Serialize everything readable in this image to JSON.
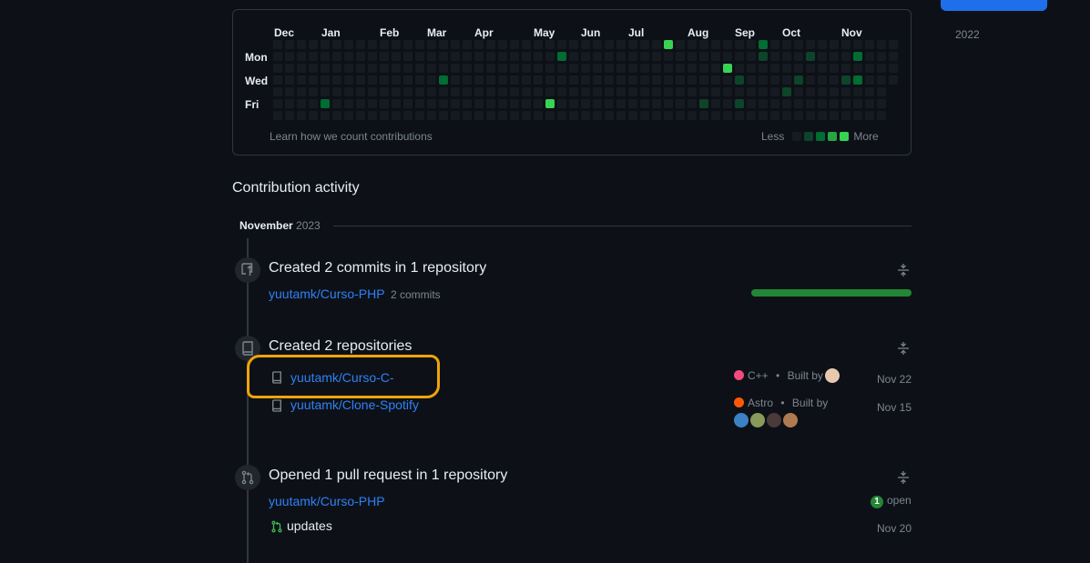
{
  "sidebar": {
    "year": "2022"
  },
  "graph": {
    "months": [
      "Dec",
      "Jan",
      "Feb",
      "Mar",
      "Apr",
      "May",
      "Jun",
      "Jul",
      "Aug",
      "Sep",
      "Oct",
      "Nov"
    ],
    "days": [
      "Mon",
      "Wed",
      "Fri"
    ],
    "learn_link": "Learn how we count contributions",
    "legend_less": "Less",
    "legend_more": "More",
    "colors": [
      "#161b22",
      "#0e4429",
      "#006d32",
      "#26a641",
      "#39d353"
    ],
    "active_cells": [
      {
        "week": 4,
        "day": 5,
        "level": 2
      },
      {
        "week": 14,
        "day": 3,
        "level": 2
      },
      {
        "week": 23,
        "day": 5,
        "level": 4
      },
      {
        "week": 24,
        "day": 1,
        "level": 2
      },
      {
        "week": 33,
        "day": 0,
        "level": 4
      },
      {
        "week": 36,
        "day": 5,
        "level": 1
      },
      {
        "week": 38,
        "day": 2,
        "level": 4
      },
      {
        "week": 39,
        "day": 3,
        "level": 1
      },
      {
        "week": 39,
        "day": 5,
        "level": 1
      },
      {
        "week": 41,
        "day": 0,
        "level": 2
      },
      {
        "week": 41,
        "day": 1,
        "level": 1
      },
      {
        "week": 43,
        "day": 4,
        "level": 1
      },
      {
        "week": 44,
        "day": 3,
        "level": 1
      },
      {
        "week": 45,
        "day": 1,
        "level": 1
      },
      {
        "week": 48,
        "day": 3,
        "level": 1
      },
      {
        "week": 49,
        "day": 1,
        "level": 2
      },
      {
        "week": 49,
        "day": 3,
        "level": 2
      }
    ]
  },
  "activity": {
    "title": "Contribution activity",
    "month": "November",
    "year": "2023",
    "commits": {
      "title": "Created 2 commits in 1 repository",
      "repo": "yuutamk/Curso-PHP",
      "count": "2 commits",
      "bar_fraction": 1.0
    },
    "repos": {
      "title": "Created 2 repositories",
      "items": [
        {
          "name": "yuutamk/Curso-C-",
          "language": "C++",
          "lang_color": "#f34b7d",
          "built_by": "Built by",
          "date": "Nov 22"
        },
        {
          "name": "yuutamk/Clone-Spotify",
          "language": "Astro",
          "lang_color": "#ff5a03",
          "built_by": "Built by",
          "date": "Nov 15"
        }
      ]
    },
    "pull_requests": {
      "title": "Opened 1 pull request in 1 repository",
      "repo": "yuutamk/Curso-PHP",
      "open_count": "1",
      "open_label": "open",
      "pr_title": "updates",
      "date": "Nov 20"
    }
  }
}
